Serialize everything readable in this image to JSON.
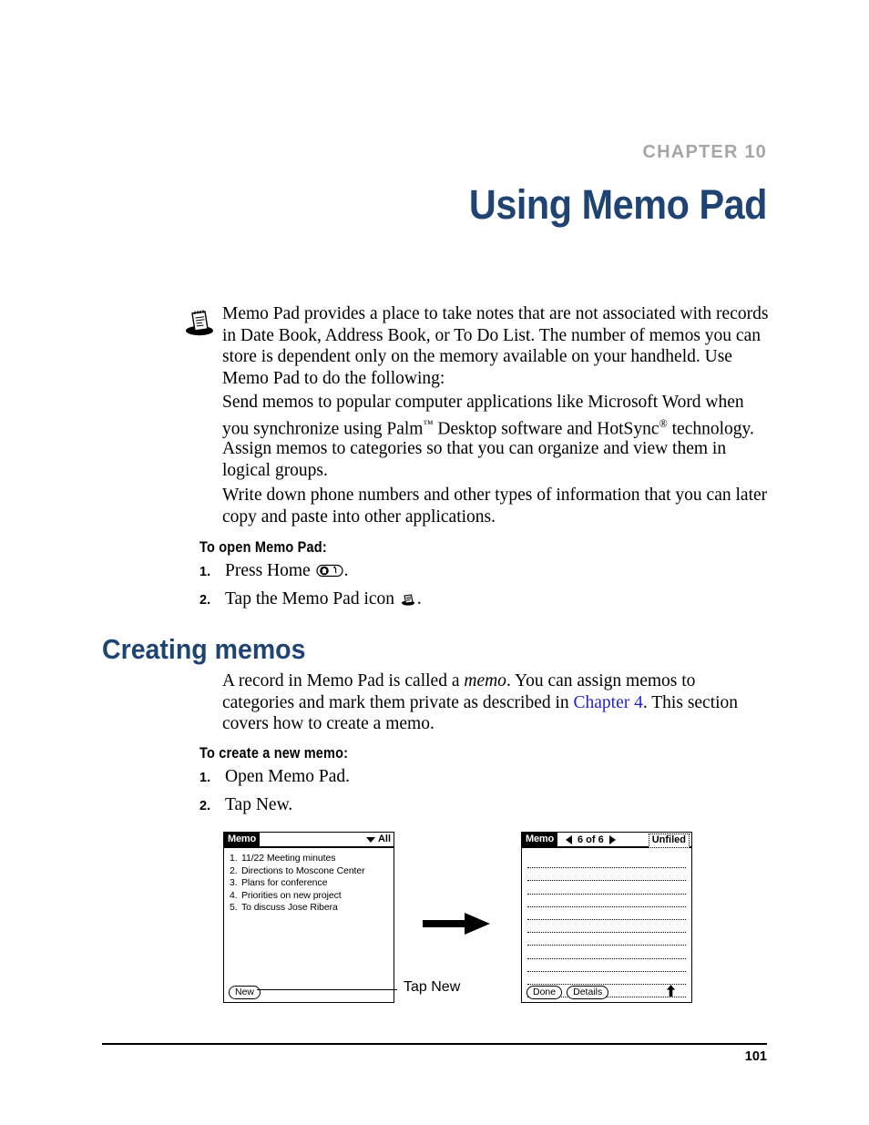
{
  "chapter": {
    "label": "CHAPTER 10",
    "title": "Using Memo Pad",
    "label_color": "#a6a6a6",
    "title_color": "#1f4473"
  },
  "intro": {
    "icon": "memo-pad-icon",
    "paragraph": "Memo Pad provides a place to take notes that are not associated with records in Date Book, Address Book, or To Do List. The number of memos you can store is dependent only on the memory available on your handheld. Use Memo Pad to do the following:"
  },
  "bullets": [
    {
      "text_before_tm": "Send memos to popular computer applications like Microsoft Word when you synchronize using Palm",
      "tm": "™",
      "text_middle": " Desktop software and HotSync",
      "reg": "®",
      "text_after": " technology."
    },
    {
      "text": "Assign memos to categories so that you can organize and view them in logical groups."
    },
    {
      "text": "Write down phone numbers and other types of information that you can later copy and paste into other applications."
    }
  ],
  "open_section": {
    "heading": "To open Memo Pad:",
    "steps": [
      {
        "num": "1.",
        "text_before": "Press Home ",
        "icon": "home-button-icon",
        "text_after": "."
      },
      {
        "num": "2.",
        "text_before": "Tap the Memo Pad icon ",
        "icon": "memo-pad-small-icon",
        "text_after": "."
      }
    ]
  },
  "creating_section": {
    "heading": "Creating memos",
    "paragraph_part1": "A record in Memo Pad is called a ",
    "paragraph_italic": "memo",
    "paragraph_part2": ". You can assign memos to categories and mark them private as described in ",
    "paragraph_link": "Chapter 4",
    "paragraph_part3": ". This section covers how to create a memo.",
    "link_color": "#2222cc"
  },
  "create_memo_section": {
    "heading": "To create a new memo:",
    "steps": [
      {
        "num": "1.",
        "text": "Open Memo Pad."
      },
      {
        "num": "2.",
        "text": "Tap New."
      }
    ]
  },
  "figure": {
    "arrow_icon": "right-arrow-icon",
    "callout_label": "Tap New",
    "left_screen": {
      "title": "Memo",
      "category_label": "All",
      "category_icon": "chevron-down-icon",
      "memos": [
        {
          "num": "1.",
          "text": "11/22 Meeting minutes"
        },
        {
          "num": "2.",
          "text": "Directions to Moscone Center"
        },
        {
          "num": "3.",
          "text": "Plans for conference"
        },
        {
          "num": "4.",
          "text": "Priorities on new project"
        },
        {
          "num": "5.",
          "text": "To discuss Jose Ribera"
        }
      ],
      "new_button": "New"
    },
    "right_screen": {
      "title": "Memo",
      "record_counter": "6 of 6",
      "prev_icon": "previous-record-icon",
      "next_icon": "next-record-icon",
      "category_label": "Unfiled",
      "line_count": 11,
      "done_button": "Done",
      "details_button": "Details",
      "scroll_icon": "scroll-up-icon"
    }
  },
  "footer": {
    "page_number": "101"
  }
}
